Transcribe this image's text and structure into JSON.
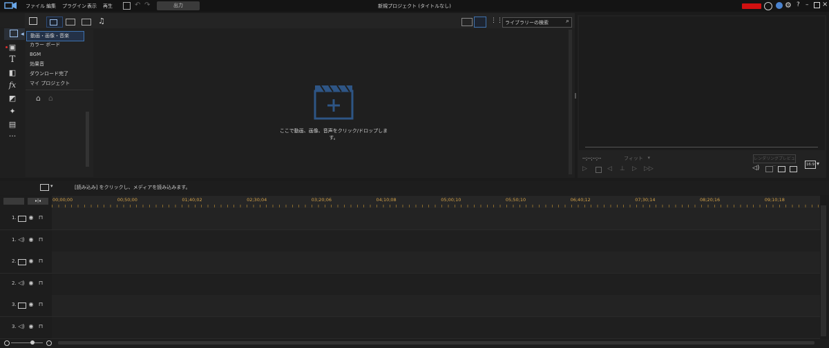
{
  "menubar": {
    "items": [
      "ファイル",
      "編集",
      "プラグイン",
      "表示",
      "再生"
    ],
    "output_label": "出力",
    "title": "新規プロジェクト (タイトルなし)"
  },
  "library": {
    "categories": [
      "動画・画像・音楽",
      "カラー ボード",
      "BGM",
      "効果音",
      "ダウンロード完了",
      "マイ プロジェクト"
    ],
    "search_placeholder": "ライブラリーの検索",
    "empty_hint": "ここで動画、画像、音声をクリック/ドロップします。"
  },
  "preview": {
    "timecode": "--;--;--;--",
    "fit_label": "フィット",
    "render_label": "レンダリングプレビュー",
    "aspect": "16:9"
  },
  "timeline": {
    "import_hint": "[読み込み] をクリックし、メディアを読み込みます。",
    "ruler": [
      "00;00;00",
      "00;50;00",
      "01;40;02",
      "02;30;04",
      "03;20;06",
      "04;10;08",
      "05;00;10",
      "05;50;10",
      "06;40;12",
      "07;30;14",
      "08;20;16",
      "09;10;18"
    ],
    "tracks": [
      {
        "label": "1.",
        "kind": "video"
      },
      {
        "label": "1.",
        "kind": "audio"
      },
      {
        "label": "2.",
        "kind": "video"
      },
      {
        "label": "2.",
        "kind": "audio"
      },
      {
        "label": "3.",
        "kind": "video"
      },
      {
        "label": "3.",
        "kind": "audio"
      }
    ]
  },
  "colors": {
    "accent": "#3f73b0",
    "ruler_text": "#d8a54a",
    "badge_red": "#d01010"
  }
}
